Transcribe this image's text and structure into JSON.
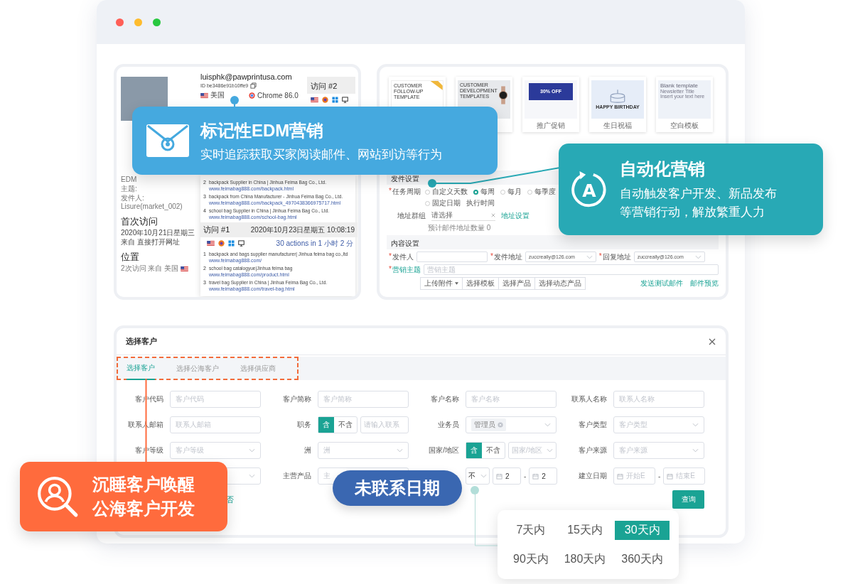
{
  "visitor_panel": {
    "email": "luisphk@pawprintusa.com",
    "visitor_id": "ID be3486e91b10ffe9",
    "country": "美国",
    "browser": "Chrome 86.0",
    "email_info": [
      "EDM",
      "主题:",
      "发件人: Lisure(market_002)"
    ],
    "first_visit": {
      "title": "首次访问",
      "lines": [
        "2020年10月21日星期三",
        "来自 直接打开网址"
      ]
    },
    "location": {
      "title": "位置",
      "line": "2次访问 来自 美国"
    },
    "visit_2": {
      "title": "访问 #2"
    },
    "pages_upper": [
      {
        "index": "2",
        "title": "backpack Supplier in China | Jinhua Feima Bag Co., Ltd.",
        "url": "www.feimabag888.com/backpack.html"
      },
      {
        "index": "3",
        "title": "backpack from China Manufacturer - Jinhua Feima Bag Co., Ltd.",
        "url": "www.feimabag888.com/backpack_4970438366975717.html"
      },
      {
        "index": "4",
        "title": "school bag Supplier in China | Jinhua Feima Bag Co., Ltd.",
        "url": "www.feimabag888.com/school-bag.html"
      }
    ],
    "visit_1": {
      "title": "访问 #1",
      "date": "2020年10月23日星期五 10:08:19",
      "actions": "30 actions in 1 小时 2 分",
      "pages": [
        {
          "index": "1",
          "title": "backpack and bags supplier manufacturer| Jinhua feima bag co.,ltd",
          "url": "www.feimabag888.com/"
        },
        {
          "index": "2",
          "title": "school bag catalogyue|Jinhua feima bag",
          "url": "www.feimabag888.com/product.html"
        },
        {
          "index": "3",
          "title": "travel bag Supplier in China | Jinhua Feima Bag Co., Ltd.",
          "url": "www.feimabag888.com/travel-bag.html"
        }
      ]
    }
  },
  "edm_panel": {
    "templates": [
      {
        "kind": "followup",
        "title": "CUSTOMER FOLLOW-UP TEMPLATE"
      },
      {
        "kind": "development",
        "title": "CUSTOMER DEVELOPMENT TEMPLATES"
      },
      {
        "kind": "promo",
        "title": "30% OFF",
        "caption": "推广促销"
      },
      {
        "kind": "birthday",
        "title": "HAPPY BIRTHDAY",
        "caption": "生日祝福"
      },
      {
        "kind": "blank",
        "title": "Blank template",
        "subtitle": "Newsletter Title",
        "note": "Insert your text here",
        "caption": "空白模板"
      }
    ],
    "send_settings": {
      "title": "发件设置",
      "cycle": {
        "mark": "*",
        "label": "任务周期",
        "options": [
          {
            "label": "自定义天数",
            "selected": false
          },
          {
            "label": "每周",
            "selected": true
          },
          {
            "label": "每月",
            "selected": false
          },
          {
            "label": "每季度",
            "selected": false
          },
          {
            "label": "固定日期",
            "selected": false
          }
        ],
        "time_label": "执行时间"
      },
      "address": {
        "label": "地址群组",
        "value": "请选择",
        "link": "地址设置",
        "note": "预计邮件地址数量 0"
      }
    },
    "content_settings": {
      "title": "内容设置",
      "fields": [
        {
          "mark": "*",
          "label": "发件人",
          "kind": "input"
        },
        {
          "mark": "*",
          "label": "发件地址",
          "kind": "select",
          "value": "zuccreally@126.com"
        },
        {
          "mark": "*",
          "label": "回复地址",
          "kind": "select",
          "value": "zuccreally@126.com"
        }
      ],
      "subject": {
        "mark": "*",
        "label": "营销主题",
        "placeholder": "营销主题"
      },
      "toolbar": [
        "上传附件",
        "选择模板",
        "选择产品",
        "选择动态产品"
      ],
      "links": [
        "发送测试邮件",
        "邮件预览"
      ]
    }
  },
  "select_customer": {
    "title": "选择客户",
    "tabs": [
      {
        "label": "选择客户",
        "selected": true
      },
      {
        "label": "选择公海客户",
        "selected": false
      },
      {
        "label": "选择供应商",
        "selected": false
      }
    ],
    "fields": [
      {
        "label": "客户代码",
        "kind": "input",
        "placeholder": "客户代码"
      },
      {
        "label": "客户简称",
        "kind": "input",
        "placeholder": "客户简称"
      },
      {
        "label": "客户名称",
        "kind": "input",
        "placeholder": "客户名称"
      },
      {
        "label": "联系人名称",
        "kind": "input",
        "placeholder": "联系人名称"
      },
      {
        "label": "联系人邮箱",
        "kind": "input",
        "placeholder": "联系人邮箱"
      },
      {
        "label": "职务",
        "kind": "toggle_input",
        "options": [
          {
            "label": "含",
            "selected": true
          },
          {
            "label": "不含",
            "selected": false
          }
        ],
        "placeholder": "请输入联系"
      },
      {
        "label": "业务员",
        "kind": "tag_select",
        "tag": "管理员"
      },
      {
        "label": "客户类型",
        "kind": "select",
        "placeholder": "客户类型"
      },
      {
        "label": "客户等级",
        "kind": "select",
        "placeholder": "客户等级"
      },
      {
        "label": "洲",
        "kind": "select",
        "placeholder": "洲"
      },
      {
        "label": "国家/地区",
        "kind": "toggle_select",
        "options": [
          {
            "label": "含",
            "selected": true
          },
          {
            "label": "不含",
            "selected": false
          }
        ],
        "placeholder": "国家/地区"
      },
      {
        "label": "客户来源",
        "kind": "select",
        "placeholder": "客户来源"
      },
      {
        "kind": "select"
      },
      {
        "label": "主营产品",
        "kind": "input",
        "placeholder": "主"
      },
      {
        "kind": "contact_date",
        "value": "不",
        "start": "2",
        "separator": "-",
        "end": "2"
      },
      {
        "label": "建立日期",
        "kind": "date_range",
        "start_placeholder": "开始E",
        "separator": "-",
        "end_placeholder": "结束E"
      }
    ],
    "footer_link": "否",
    "query_button": "查询"
  },
  "edm_callout": {
    "title": "标记性EDM营销",
    "text": "实时追踪获取买家阅读邮件、网站到访等行为"
  },
  "automation_callout": {
    "icon_letter": "A",
    "title": "自动化营销",
    "text": "自动触发客户开发、新品发布等营销行动，解放繁重人力"
  },
  "dormant_callout": {
    "text": "沉睡客户唤醒公海客户开发"
  },
  "date_pill": {
    "text": "未联系日期"
  },
  "date_popup": {
    "options": [
      {
        "label": "7天内",
        "selected": false
      },
      {
        "label": "15天内",
        "selected": false
      },
      {
        "label": "30天内",
        "selected": true
      },
      {
        "label": "90天内",
        "selected": false
      },
      {
        "label": "180天内",
        "selected": false
      },
      {
        "label": "360天内",
        "selected": false
      }
    ]
  }
}
